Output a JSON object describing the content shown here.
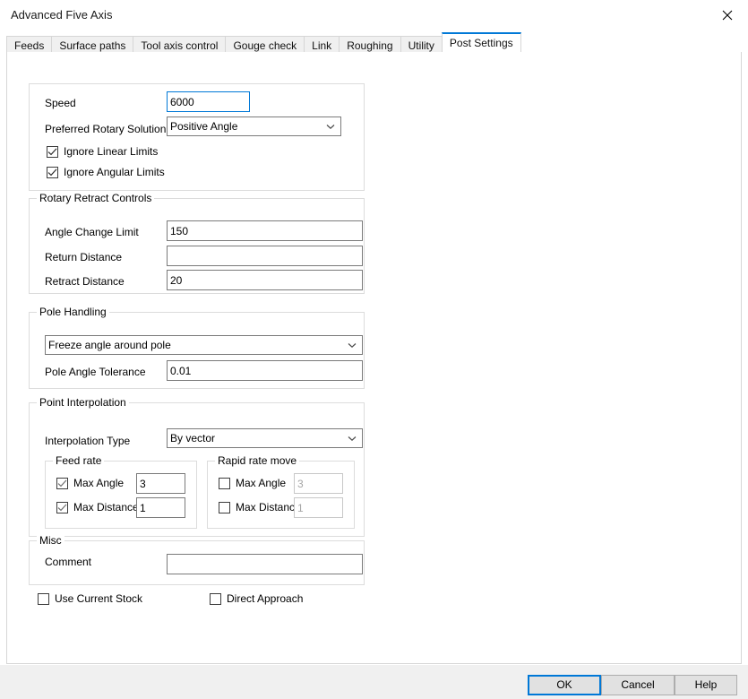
{
  "window": {
    "title": "Advanced Five Axis",
    "close_icon": "close-icon"
  },
  "tabs": [
    {
      "label": "Feeds",
      "active": false
    },
    {
      "label": "Surface paths",
      "active": false
    },
    {
      "label": "Tool axis control",
      "active": false
    },
    {
      "label": "Gouge check",
      "active": false
    },
    {
      "label": "Link",
      "active": false
    },
    {
      "label": "Roughing",
      "active": false
    },
    {
      "label": "Utility",
      "active": false
    },
    {
      "label": "Post Settings",
      "active": true
    }
  ],
  "general": {
    "speed_label": "Speed",
    "speed_value": "6000",
    "rotary_solution_label": "Preferred Rotary Solution",
    "rotary_solution_value": "Positive Angle",
    "ignore_linear_label": "Ignore Linear Limits",
    "ignore_linear_checked": true,
    "ignore_angular_label": "Ignore Angular Limits",
    "ignore_angular_checked": true
  },
  "rotary_retract": {
    "title": "Rotary Retract Controls",
    "angle_change_limit_label": "Angle Change Limit",
    "angle_change_limit_value": "150",
    "return_distance_label": "Return Distance",
    "return_distance_value": "",
    "retract_distance_label": "Retract Distance",
    "retract_distance_value": "20"
  },
  "pole_handling": {
    "title": "Pole Handling",
    "mode_value": "Freeze angle around pole",
    "tolerance_label": "Pole Angle Tolerance",
    "tolerance_value": "0.01"
  },
  "point_interpolation": {
    "title": "Point Interpolation",
    "type_label": "Interpolation Type",
    "type_value": "By vector",
    "feed_rate": {
      "title": "Feed rate",
      "max_angle_label": "Max Angle",
      "max_angle_checked": true,
      "max_angle_value": "3",
      "max_distance_label": "Max Distance",
      "max_distance_checked": true,
      "max_distance_value": "1"
    },
    "rapid_rate": {
      "title": "Rapid rate move",
      "max_angle_label": "Max Angle",
      "max_angle_checked": false,
      "max_angle_value": "3",
      "max_distance_label": "Max Distance",
      "max_distance_checked": false,
      "max_distance_value": "1"
    }
  },
  "misc": {
    "title": "Misc",
    "comment_label": "Comment",
    "comment_value": "",
    "use_current_stock_label": "Use Current Stock",
    "use_current_stock_checked": false,
    "direct_approach_label": "Direct Approach",
    "direct_approach_checked": false
  },
  "footer": {
    "ok_label": "OK",
    "cancel_label": "Cancel",
    "help_label": "Help"
  },
  "colors": {
    "accent": "#0078d7",
    "window_bg": "#ffffff",
    "footer_bg": "#f0f0f0",
    "border": "#dcdcdc",
    "input_border": "#7a7a7a",
    "disabled_text": "#a6a6a6"
  }
}
